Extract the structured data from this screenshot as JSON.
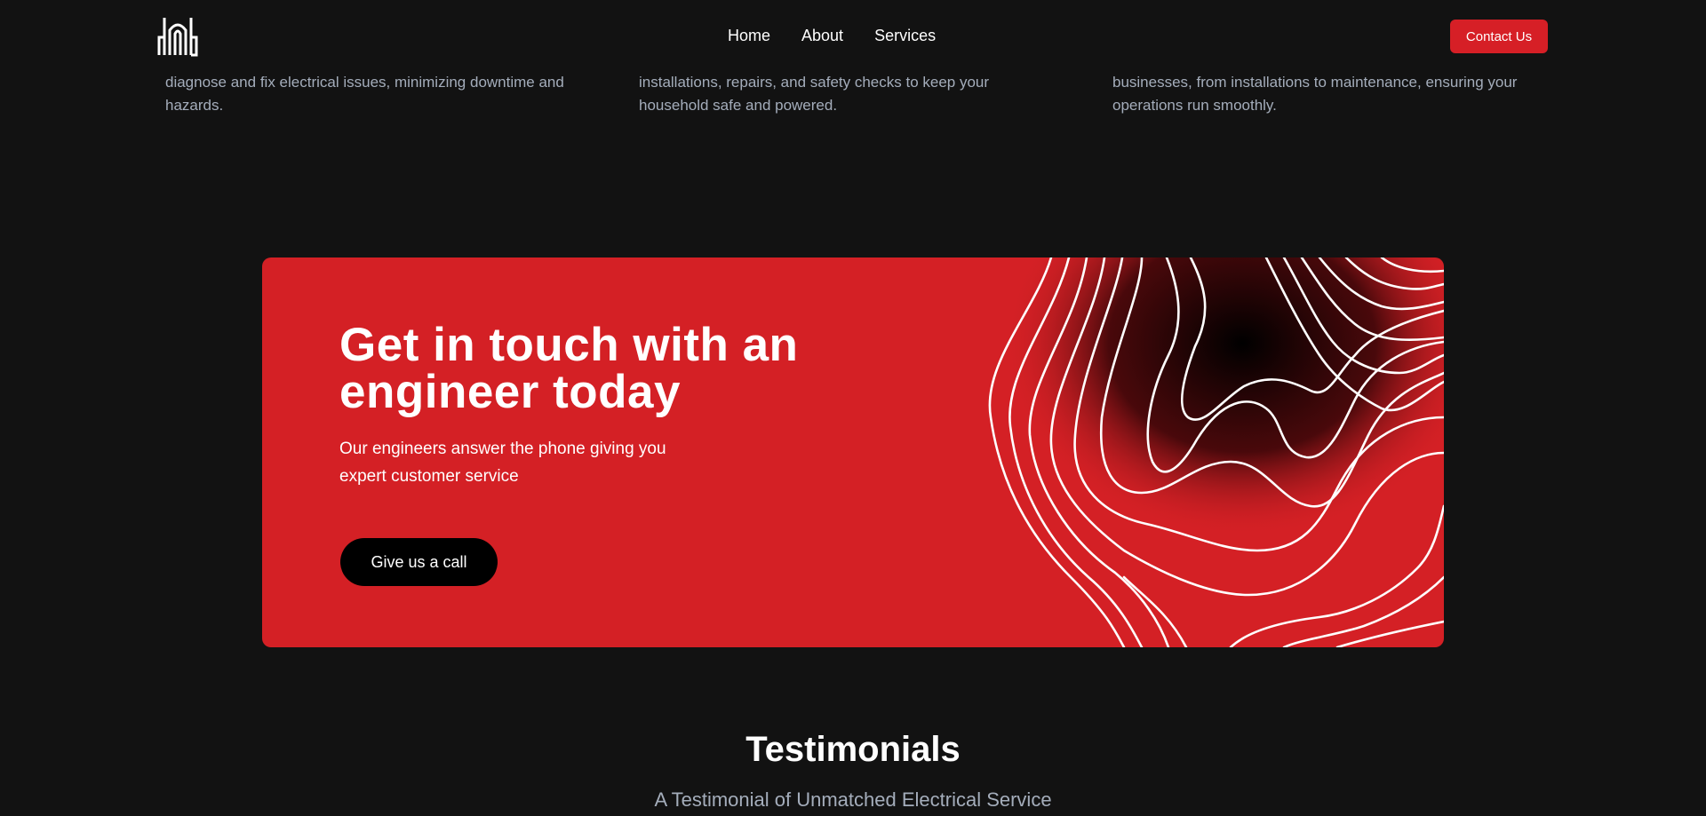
{
  "header": {
    "logo_alt": "dnb",
    "nav": [
      "Home",
      "About",
      "Services"
    ],
    "contact_label": "Contact Us"
  },
  "services": [
    {
      "text": "diagnose and fix electrical issues, minimizing downtime and hazards."
    },
    {
      "text": "installations, repairs, and safety checks to keep your household safe and powered."
    },
    {
      "text": "businesses, from installations to maintenance, ensuring your operations run smoothly."
    }
  ],
  "cta": {
    "title_line1": "Get in touch with an",
    "title_line2": "engineer today",
    "subtitle_line1": "Our engineers answer the phone giving you",
    "subtitle_line2": "expert customer service",
    "button_label": "Give us a call"
  },
  "testimonials": {
    "title": "Testimonials",
    "subtitle": "A Testimonial of Unmatched Electrical Service"
  },
  "colors": {
    "background": "#121212",
    "accent": "#d42025",
    "muted_text": "#a4adbb"
  }
}
